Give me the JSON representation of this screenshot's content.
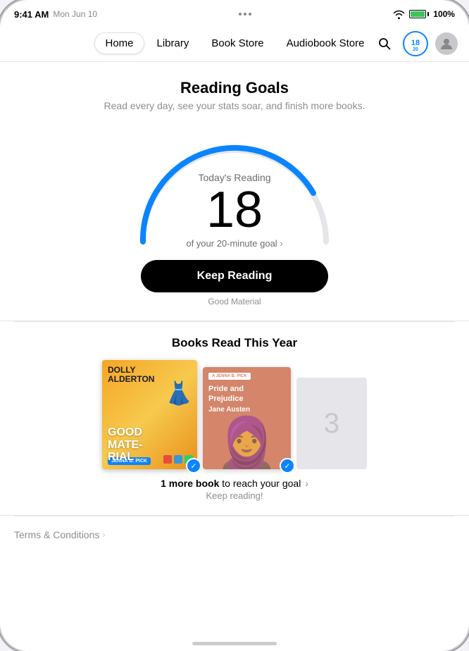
{
  "device": {
    "time": "9:41 AM",
    "date": "Mon Jun 10",
    "wifi": "wifi",
    "battery": "100%"
  },
  "nav": {
    "items": [
      {
        "label": "Home",
        "active": true
      },
      {
        "label": "Library",
        "active": false
      },
      {
        "label": "Book Store",
        "active": false
      },
      {
        "label": "Audiobook Store",
        "active": false
      }
    ],
    "progress_number": "18",
    "progress_total": "20"
  },
  "reading_goals": {
    "title": "Reading Goals",
    "subtitle": "Read every day, see your stats soar, and finish more books.",
    "today_label": "Today's Reading",
    "minutes": "18",
    "goal_text": "of your 20-minute goal",
    "keep_reading_label": "Keep Reading",
    "current_book": "Good Material"
  },
  "books_section": {
    "title": "Books Read This Year",
    "book1": {
      "title": "DOLLY\nALDERTON\nGOOD\nMATERIAL",
      "author": "",
      "completed": true
    },
    "book2": {
      "title": "Pride and\nPrejudice",
      "author": "Jane Austen",
      "badge": "A JENNA B.",
      "completed": true
    },
    "placeholder_number": "3",
    "goal_text_prefix": "1 more book",
    "goal_text_suffix": " to reach your goal",
    "keep_reading": "Keep reading!"
  },
  "terms": {
    "label": "Terms & Conditions",
    "chevron": "›"
  },
  "home_indicator": true
}
